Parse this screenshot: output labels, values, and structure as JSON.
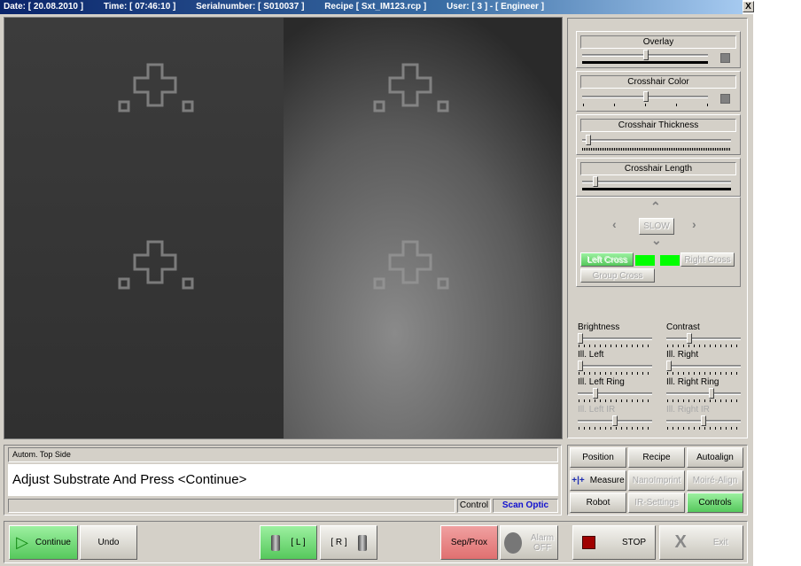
{
  "titlebar": {
    "date": "Date: [ 20.08.2010 ]",
    "time": "Time: [ 07:46:10 ]",
    "serial": "Serialnumber: [ S010037 ]",
    "recipe": "Recipe [ Sxt_IM123.rcp ]",
    "user": "User: [ 3 ] - [ Engineer ]",
    "close": "X"
  },
  "overlay": {
    "label": "Overlay",
    "value": 0.5
  },
  "crosshair_color": {
    "label": "Crosshair Color",
    "value": 0.5
  },
  "crosshair_thickness": {
    "label": "Crosshair Thickness",
    "value": 0.05
  },
  "crosshair_length": {
    "label": "Crosshair Length",
    "value": 0.1
  },
  "nav": {
    "slow": "SLOW",
    "left_cross": "Left Cross",
    "right_cross": "Right Cross",
    "group_cross": "Group Cross",
    "indicator_color": "#00ff00"
  },
  "sliders": [
    {
      "label": "Brightness",
      "value": 0.0,
      "disabled": false
    },
    {
      "label": "Contrast",
      "value": 0.3,
      "disabled": false
    },
    {
      "label": "Ill. Left",
      "value": 0.0,
      "disabled": false
    },
    {
      "label": "Ill. Right",
      "value": 0.0,
      "disabled": false
    },
    {
      "label": "Ill. Left Ring",
      "value": 0.22,
      "disabled": false
    },
    {
      "label": "Ill. Right Ring",
      "value": 0.62,
      "disabled": false
    },
    {
      "label": "Ill. Left IR",
      "value": 0.5,
      "disabled": true
    },
    {
      "label": "Ill. Right IR",
      "value": 0.5,
      "disabled": true
    }
  ],
  "menu": {
    "position": "Position",
    "recipe": "Recipe",
    "autoalign": "Autoalign",
    "measure": "Measure",
    "nanoimprint": "NanoImprint",
    "moire": "Moiré-Align",
    "robot": "Robot",
    "ir_settings": "IR-Settings",
    "controls": "Controls"
  },
  "message": {
    "mode": "Autom. Top Side",
    "text": "Adjust Substrate And Press <Continue>",
    "status1": "",
    "control": "Control",
    "scan": "Scan Optic"
  },
  "toolbar": {
    "continue": "Continue",
    "undo": "Undo",
    "left": "[ L ]",
    "right": "[ R ]",
    "sep_prox": "Sep/Prox",
    "alarm1": "Alarm",
    "alarm2": "OFF",
    "stop": "STOP",
    "exit": "Exit"
  }
}
